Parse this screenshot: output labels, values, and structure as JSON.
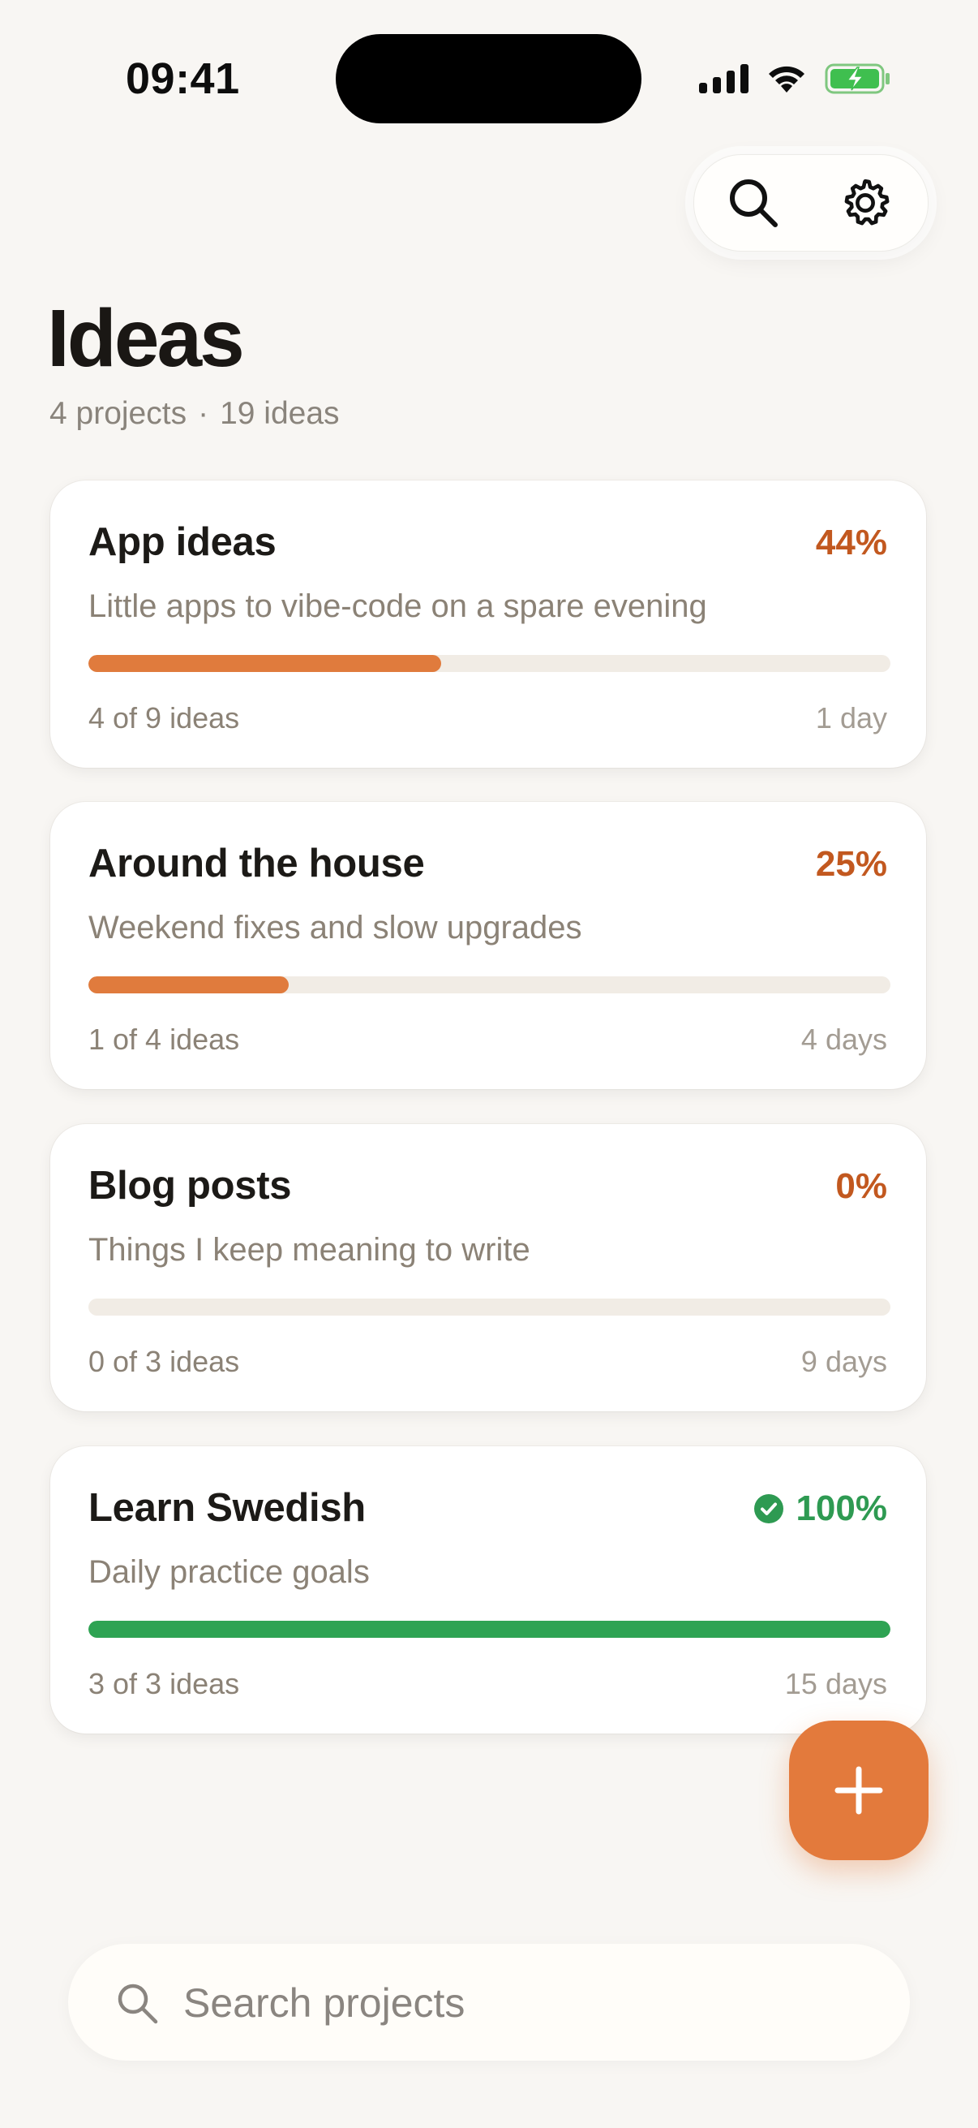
{
  "status_bar": {
    "time": "09:41"
  },
  "header": {
    "title": "Ideas",
    "projects_count": "4 projects",
    "separator": "·",
    "ideas_count": "19 ideas"
  },
  "toolbar": {
    "search_icon": "search-icon",
    "settings_icon": "gear-icon"
  },
  "projects": [
    {
      "name": "App ideas",
      "percent_label": "44%",
      "progress": 0.44,
      "description": "Little apps to vibe-code on a spare evening",
      "count": "4 of 9 ideas",
      "age": "1 day"
    },
    {
      "name": "Around the house",
      "percent_label": "25%",
      "progress": 0.25,
      "description": "Weekend fixes and slow upgrades",
      "count": "1 of 4 ideas",
      "age": "4 days"
    },
    {
      "name": "Blog posts",
      "percent_label": "0%",
      "progress": 0.0,
      "description": "Things I keep meaning to write",
      "count": "0 of 3 ideas",
      "age": "9 days"
    },
    {
      "name": "Learn Swedish",
      "percent_label": "100%",
      "progress": 1.0,
      "complete": true,
      "description": "Daily practice goals",
      "count": "3 of 3 ideas",
      "age": "15 days"
    }
  ],
  "fab": {
    "icon": "plus-icon"
  },
  "search": {
    "placeholder": "Search projects",
    "value": ""
  },
  "colors": {
    "accent": "#e07b3d",
    "accent_text": "#c2581f",
    "success": "#2ea353",
    "background": "#f8f6f3"
  }
}
